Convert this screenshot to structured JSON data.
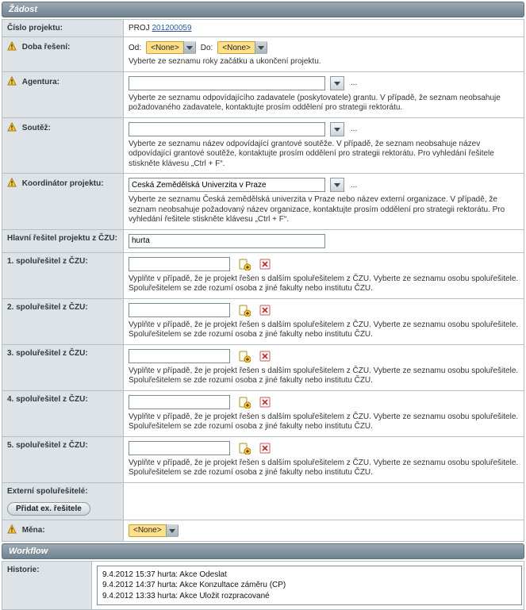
{
  "sections": {
    "request": "Žádost",
    "workflow": "Workflow"
  },
  "labels": {
    "projectNo": "Číslo projektu:",
    "duration": "Doba řešení:",
    "agency": "Agentura:",
    "competition": "Soutěž:",
    "coordinator": "Koordinátor projektu:",
    "mainInvestigator": "Hlavní řešitel projektu z ČZU:",
    "co1": "1. spoluřešitel z ČZU:",
    "co2": "2. spoluřešitel z ČZU:",
    "co3": "3. spoluřešitel z ČZU:",
    "co4": "4. spoluřešitel z ČZU:",
    "co5": "5. spoluřešitel z ČZU:",
    "external": "Externí spoluřešitelé:",
    "currency": "Měna:",
    "history": "Historie:"
  },
  "project": {
    "prefix": "PROJ",
    "number": "201200059"
  },
  "duration": {
    "fromLabel": "Od:",
    "fromValue": "<None>",
    "toLabel": "Do:",
    "toValue": "<None>",
    "help": "Vyberte ze seznamu roky začátku a ukončení projektu."
  },
  "agency": {
    "value": "",
    "help": "Vyberte ze seznamu odpovídajícího zadavatele (poskytovatele) grantu. V případě, že seznam neobsahuje požadovaného zadavatele, kontaktujte prosím oddělení pro strategii rektorátu."
  },
  "competition": {
    "value": "",
    "help": "Vyberte ze seznamu název odpovídající grantové soutěže. V případě, že seznam neobsahuje název odpovídající grantové soutěže, kontaktujte prosím oddělení pro strategii rektorátu. Pro vyhledání řešitele stiskněte klávesu „Ctrl + F“."
  },
  "coordinator": {
    "value": "Česká Zemědělská Univerzita v Praze",
    "help": "Vyberte ze seznamu Česká zemědělská univerzita v Praze nebo název externí organizace. V případě, že seznam neobsahuje požadovaný název organizace, kontaktujte prosím oddělení pro strategii rektorátu. Pro vyhledání řešitele stiskněte klávesu „Ctrl + F“."
  },
  "mainInvestigator": {
    "value": "hurta"
  },
  "coHelp": "Vyplňte v případě, že je projekt řešen s dalším spoluřešitelem z ČZU. Vyberte ze seznamu osobu spoluřešitele. Spoluřešitelem se zde rozumí osoba z jiné fakulty nebo institutu ČZU.",
  "coValues": {
    "c1": "",
    "c2": "",
    "c3": "",
    "c4": "",
    "c5": ""
  },
  "buttons": {
    "addExternal": "Přidat ex. řešitele"
  },
  "currency": {
    "value": "<None>"
  },
  "ellipsis": "...",
  "history": {
    "lines": [
      "9.4.2012 15:37 hurta: Akce Odeslat",
      "9.4.2012 14:37 hurta: Akce Konzultace záměru (CP)",
      "9.4.2012 13:33 hurta: Akce Uložit rozpracované"
    ]
  }
}
